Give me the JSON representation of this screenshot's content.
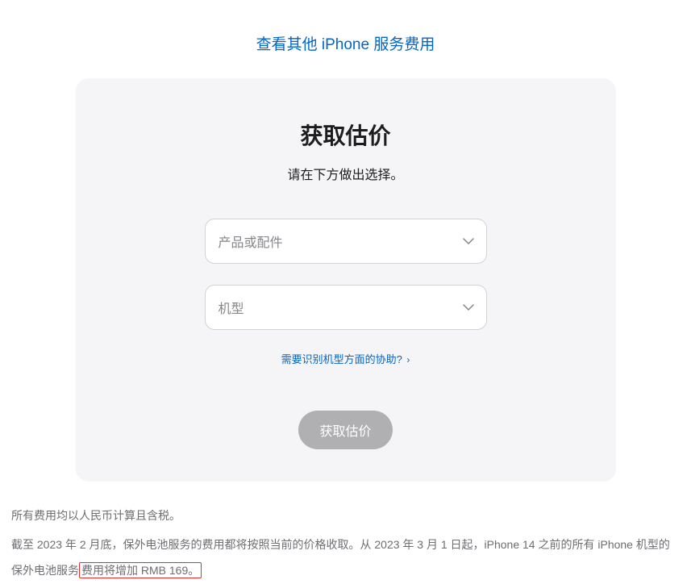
{
  "topLink": {
    "text": "查看其他 iPhone 服务费用"
  },
  "card": {
    "title": "获取估价",
    "subtitle": "请在下方做出选择。",
    "select1": {
      "placeholder": "产品或配件"
    },
    "select2": {
      "placeholder": "机型"
    },
    "helpLink": {
      "text": "需要识别机型方面的协助? ",
      "arrow": "›"
    },
    "submitButton": "获取估价"
  },
  "footer": {
    "line1": "所有费用均以人民币计算且含税。",
    "line2_part1": "截至 2023 年 2 月底，保外电池服务的费用都将按照当前的价格收取。从 2023 年 3 月 1 日起，iPhone 14 之前的所有 iPhone 机型的保外电池服务",
    "line2_highlight": "费用将增加 RMB 169。"
  }
}
